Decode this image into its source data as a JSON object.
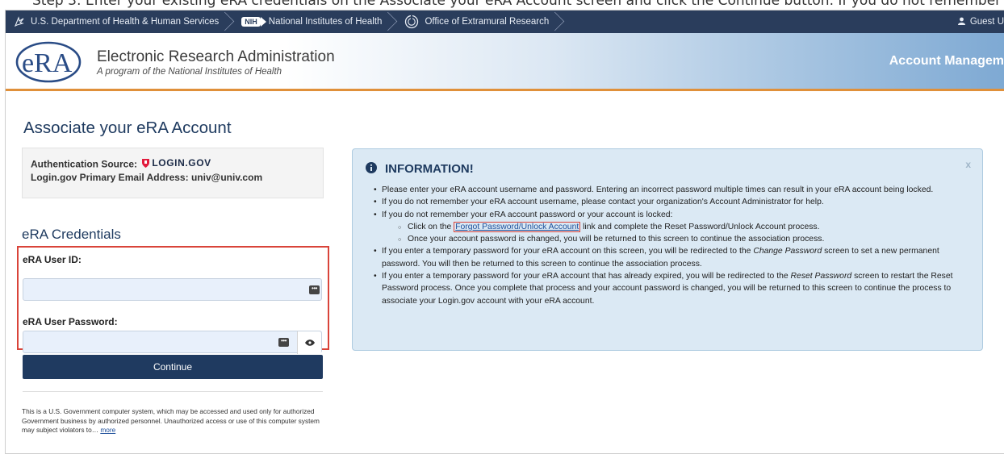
{
  "caption_fragment": "(partially cropped caption text above screenshot)",
  "top_bar": {
    "crumbs": [
      {
        "label": "U.S. Department of Health & Human Services"
      },
      {
        "label": "National Institutes of Health",
        "badge": "NIH"
      },
      {
        "label": "Office of Extramural Research"
      }
    ],
    "user_label": "Guest U"
  },
  "header": {
    "logo_text": "eRA",
    "title": "Electronic Research Administration",
    "subtitle": "A program of the National Institutes of Health",
    "right_title": "Account Managem"
  },
  "main": {
    "page_title": "Associate your eRA Account",
    "auth": {
      "source_label": "Authentication Source:",
      "source_value": "LOGIN.GOV",
      "email_label": "Login.gov Primary Email Address:",
      "email_value": "univ@univ.com"
    },
    "credentials_title": "eRA Credentials",
    "user_id_label": "eRA User ID:",
    "user_id_value": "",
    "password_label": "eRA User Password:",
    "password_value": "",
    "continue_label": "Continue",
    "disclaimer": "This is a U.S. Government computer system, which may be accessed and used only for authorized Government business by authorized personnel. Unauthorized access or use of this computer system may subject violators to…",
    "more_label": "more"
  },
  "info": {
    "heading": "INFORMATION!",
    "close": "x",
    "b1": "Please enter your eRA account username and password. Entering an incorrect password multiple times can result in your eRA account being locked.",
    "b2": "If you do not remember your eRA account username, please contact your organization's Account Administrator for help.",
    "b3": "If you do not remember your eRA account password or your account is locked:",
    "s1_pre": "Click on the",
    "s1_link": "Forgot Password/Unlock Account",
    "s1_post": "link and complete the Reset Password/Unlock Account process.",
    "s2": "Once your account password is changed, you will be returned to this screen to continue the association process.",
    "b4_pre": "If you enter a temporary password for your eRA account on this screen, you will be redirected to the",
    "b4_em": "Change Password",
    "b4_post": "screen to set a new permanent password. You will then be returned to this screen to continue the association process.",
    "b5_pre": "If you enter a temporary password for your eRA account that has already expired, you will be redirected to the",
    "b5_em": "Reset Password",
    "b5_post": "screen to restart the Reset Password process. Once you complete that process and your account password is changed, you will be returned to this screen to continue the process to associate your Login.gov account with your eRA account."
  },
  "colors": {
    "navy": "#2a3d5c",
    "button": "#1f3a60",
    "accent_orange": "#e0903a",
    "highlight_red": "#d9443a",
    "info_bg": "#dbe9f4"
  }
}
